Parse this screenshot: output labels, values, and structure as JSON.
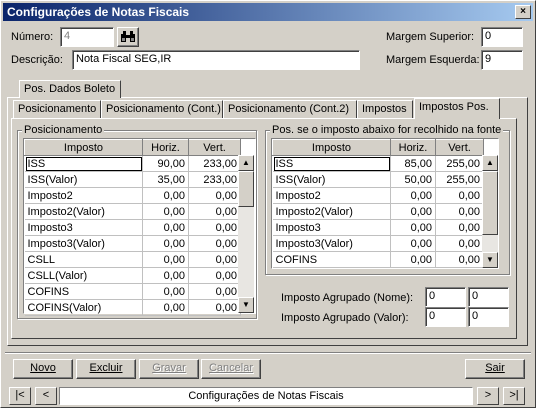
{
  "window": {
    "title": "Configurações de Notas Fiscais",
    "close_label": "×"
  },
  "header": {
    "numero_label": "Número:",
    "numero_value": "4",
    "descricao_label": "Descrição:",
    "descricao_value": "Nota Fiscal SEG,IR",
    "margem_superior_label": "Margem Superior:",
    "margem_superior_value": "0",
    "margem_esquerda_label": "Margem Esquerda:",
    "margem_esquerda_value": "9"
  },
  "tabs": {
    "outer": "Pos. Dados Boleto",
    "inner": [
      "Posicionamento",
      "Posicionamento (Cont.)",
      "Posicionamento (Cont.2)",
      "Impostos",
      "Impostos Pos."
    ]
  },
  "left_group": {
    "title": "Posicionamento",
    "columns": [
      "Imposto",
      "Horiz.",
      "Vert."
    ],
    "rows": [
      [
        "ISS",
        "90,00",
        "233,00"
      ],
      [
        "ISS(Valor)",
        "35,00",
        "233,00"
      ],
      [
        "Imposto2",
        "0,00",
        "0,00"
      ],
      [
        "Imposto2(Valor)",
        "0,00",
        "0,00"
      ],
      [
        "Imposto3",
        "0,00",
        "0,00"
      ],
      [
        "Imposto3(Valor)",
        "0,00",
        "0,00"
      ],
      [
        "CSLL",
        "0,00",
        "0,00"
      ],
      [
        "CSLL(Valor)",
        "0,00",
        "0,00"
      ],
      [
        "COFINS",
        "0,00",
        "0,00"
      ],
      [
        "COFINS(Valor)",
        "0,00",
        "0,00"
      ]
    ]
  },
  "right_group": {
    "title": "Pos. se o imposto abaixo for recolhido na fonte",
    "columns": [
      "Imposto",
      "Horiz.",
      "Vert."
    ],
    "rows": [
      [
        "ISS",
        "85,00",
        "255,00"
      ],
      [
        "ISS(Valor)",
        "50,00",
        "255,00"
      ],
      [
        "Imposto2",
        "0,00",
        "0,00"
      ],
      [
        "Imposto2(Valor)",
        "0,00",
        "0,00"
      ],
      [
        "Imposto3",
        "0,00",
        "0,00"
      ],
      [
        "Imposto3(Valor)",
        "0,00",
        "0,00"
      ],
      [
        "COFINS",
        "0,00",
        "0,00"
      ]
    ]
  },
  "agrupado": {
    "nome_label": "Imposto Agrupado (Nome):",
    "nome_x": "0",
    "nome_y": "0",
    "valor_label": "Imposto Agrupado (Valor):",
    "valor_x": "0",
    "valor_y": "0"
  },
  "buttons": {
    "novo": "Novo",
    "excluir": "Excluir",
    "gravar": "Gravar",
    "cancelar": "Cancelar",
    "sair": "Sair"
  },
  "navigator": {
    "first": "|<",
    "prev": "<",
    "caption": "Configurações de Notas Fiscais",
    "next": ">",
    "last": ">|"
  },
  "icons": {
    "search": "binoculars-icon"
  }
}
